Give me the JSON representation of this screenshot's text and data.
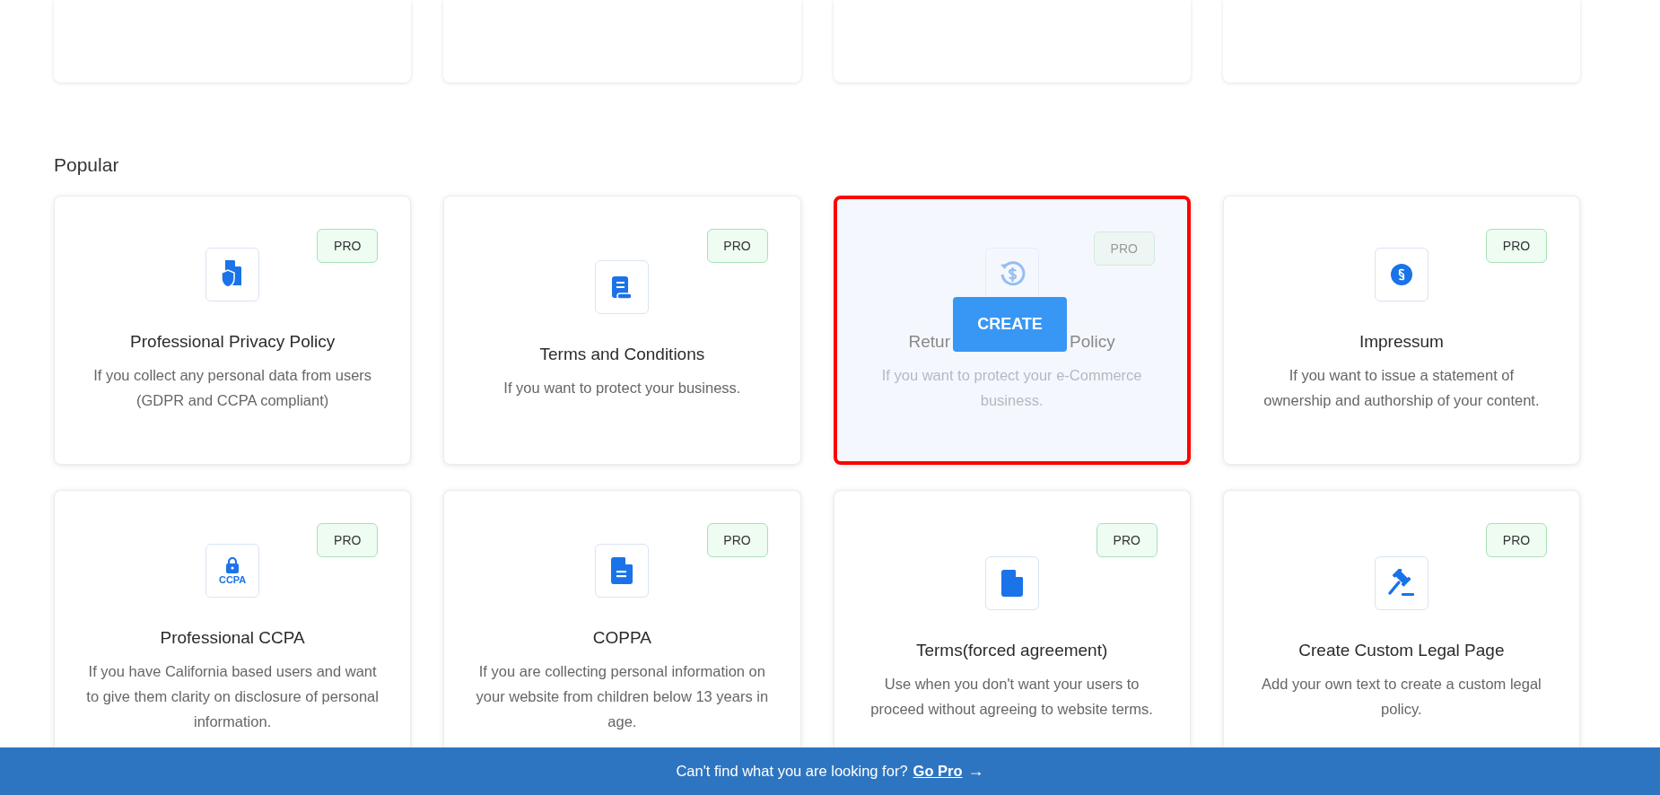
{
  "top_cards": [
    {
      "kind": "card"
    },
    {
      "kind": "card"
    },
    {
      "kind": "card"
    },
    {
      "kind": "card"
    }
  ],
  "section_title": "Popular",
  "cards": [
    {
      "kind": "shield-doc",
      "badge": "PRO",
      "title": "Professional Privacy Policy",
      "description": "If you collect any personal data from users (GDPR and CCPA compliant)",
      "hovered": false
    },
    {
      "kind": "scroll",
      "badge": "PRO",
      "title": "Terms and Conditions",
      "description": "If you want to protect your business.",
      "hovered": false
    },
    {
      "kind": "refund",
      "badge": "PRO",
      "title_parts": [
        "Retur",
        "Policy"
      ],
      "description": "If you want to protect your e-Commerce business.",
      "hovered": true,
      "action": "CREATE"
    },
    {
      "kind": "section",
      "badge": "PRO",
      "title": "Impressum",
      "description": "If you want to issue a statement of ownership and authorship of your content.",
      "hovered": false
    },
    {
      "kind": "ccpa",
      "icon_text": "CCPA",
      "badge": "PRO",
      "title": "Professional CCPA",
      "description": "If you have California based users and want to give them clarity on disclosure of personal information.",
      "hovered": false
    },
    {
      "kind": "doc-lines",
      "badge": "PRO",
      "title": "COPPA",
      "description": "If you are collecting personal information on your website from children below 13 years in age.",
      "hovered": false
    },
    {
      "kind": "doc",
      "badge": "PRO",
      "title": "Terms(forced agreement)",
      "description": "Use when you don't want your users to proceed without agreeing to website terms.",
      "hovered": false
    },
    {
      "kind": "gavel",
      "badge": "PRO",
      "title": "Create Custom Legal Page",
      "description": "Add your own text to create a custom legal policy.",
      "hovered": false
    }
  ],
  "footer": {
    "text": "Can't find what you are looking for?",
    "link": "Go Pro",
    "arrow": "→"
  }
}
